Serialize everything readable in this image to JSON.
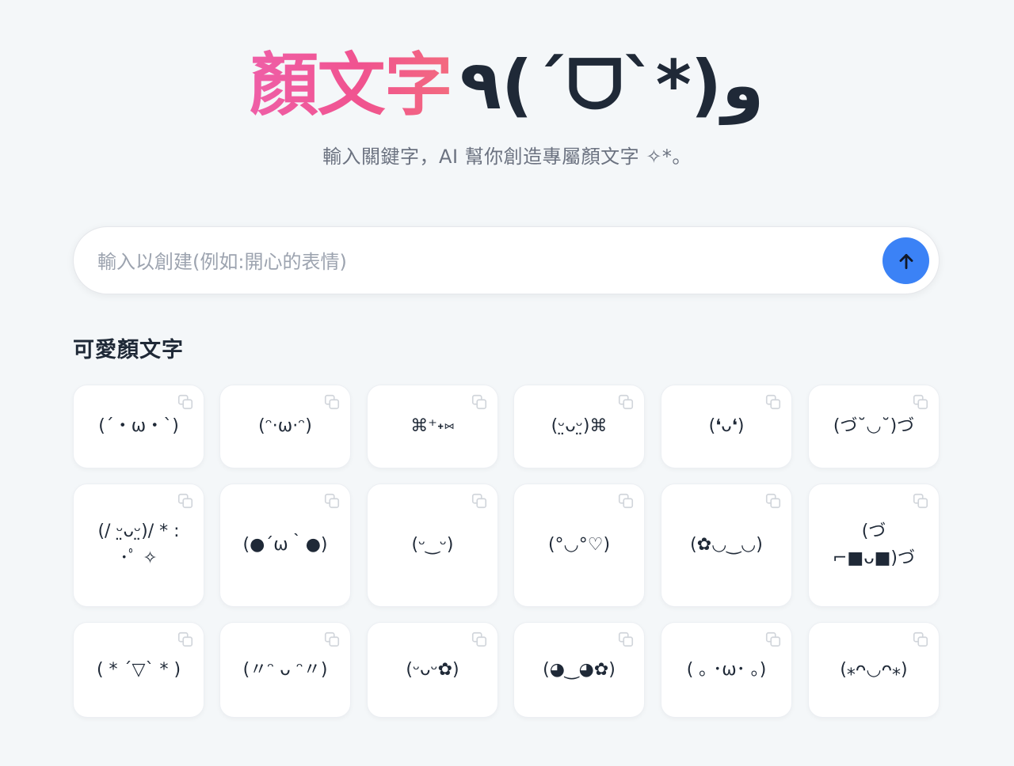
{
  "header": {
    "title_cn": "顏文字",
    "title_kaomoji": "٩(ˊᗜˋ*)و",
    "subtitle": "輸入關鍵字，AI 幫你創造專屬顏文字 ✧*。"
  },
  "search": {
    "placeholder": "輸入以創建(例如:開心的表情)",
    "value": ""
  },
  "section": {
    "title": "可愛顏文字"
  },
  "kaomojis": [
    "(´・ω・`)",
    "(ᵔ·ω·ᵔ)",
    "⌘⁺˖⑅",
    "(ᵕ̤ᴗᵕ̤)⌘",
    "(❛ᴗ❛)",
    "(づ˘◡˘)づ",
    "(/ ᵕ̤ᴗᵕ̤)/ * : ･ﾟ ✧",
    "(●´ω｀●)",
    "(ᵕ‿ᵕ)",
    "(°◡°♡)",
    "(✿◡‿◡)",
    "(づ⌐■ᴗ■)づ",
    "( * ´▽` * )",
    "(〃ᵔ ᴗ ᵔ〃)",
    "(ᵕᴗᵕ✿)",
    "(◕‿◕✿)",
    "( ｡ ･ω･ ｡)",
    "(⁎ᴖ◡ᴖ⁎)"
  ],
  "colors": {
    "accent": "#3b82f6",
    "title_gradient_start": "#ef5fa7",
    "title_gradient_end": "#f36b7f",
    "background": "#f4f7f9"
  },
  "icons": {
    "submit": "arrow-up-icon",
    "copy": "copy-icon"
  }
}
